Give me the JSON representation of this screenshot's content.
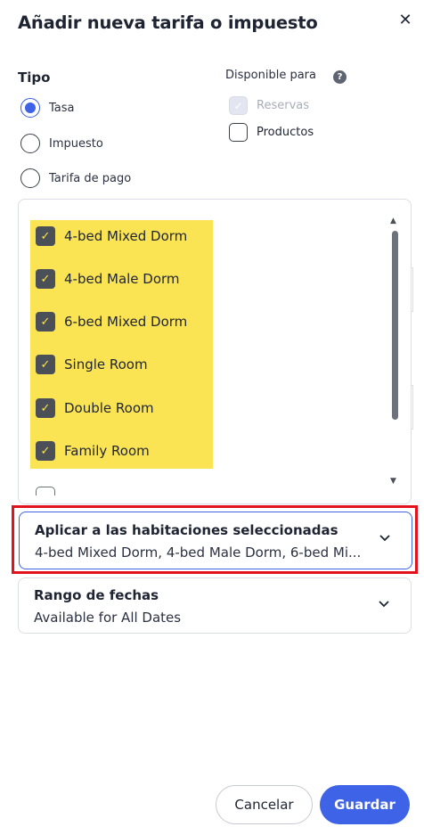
{
  "header": {
    "title": "Añadir nueva tarifa o impuesto",
    "close_icon": "close-icon"
  },
  "tipo": {
    "label": "Tipo",
    "options": [
      {
        "label": "Tasa",
        "selected": true
      },
      {
        "label": "Impuesto",
        "selected": false
      },
      {
        "label": "Tarifa de pago",
        "selected": false
      }
    ]
  },
  "disponible": {
    "label": "Disponible para",
    "help_icon": "help-icon",
    "options": [
      {
        "label": "Reservas",
        "checked": true,
        "disabled": true
      },
      {
        "label": "Productos",
        "checked": false,
        "disabled": false
      }
    ]
  },
  "rooms_dropdown": {
    "items": [
      {
        "label": "4-bed Mixed Dorm",
        "checked": true
      },
      {
        "label": "4-bed Male Dorm",
        "checked": true
      },
      {
        "label": "6-bed Mixed Dorm",
        "checked": true
      },
      {
        "label": "Single Room",
        "checked": true
      },
      {
        "label": "Double Room",
        "checked": true
      },
      {
        "label": "Family Room",
        "checked": true
      }
    ],
    "highlight_color": "#fbe453"
  },
  "apply_rooms": {
    "title": "Aplicar a las habitaciones seleccionadas",
    "value": "4-bed Mixed Dorm, 4-bed Male Dorm, 6-bed Mi..."
  },
  "date_range": {
    "title": "Rango de fechas",
    "value": "Available for All Dates"
  },
  "footer": {
    "cancel_label": "Cancelar",
    "save_label": "Guardar"
  },
  "colors": {
    "accent": "#3e63e6",
    "highlight_frame": "#e3131d"
  }
}
